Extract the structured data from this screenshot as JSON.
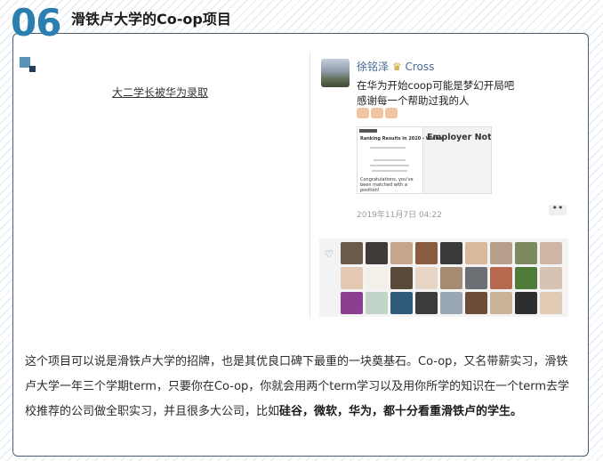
{
  "section": {
    "number": "06",
    "title": "滑铁卢大学的Co-op项目"
  },
  "link_caption": "大二学长被华为录取",
  "post": {
    "name": "徐铭泽",
    "name_suffix": "Cross",
    "line1": "在华为开始coop可能是梦幻开局吧",
    "line2": "感谢每一个帮助过我的人",
    "attachment": {
      "doc_heading": "Ranking Results in 2020 - Winter",
      "doc_text": "Congratulations, you've been matched with a position!",
      "employer_label": "Employer Note"
    },
    "timestamp": "2019年11月7日 04:22",
    "more_label": "••"
  },
  "likes": {
    "heart_icon": "heart-icon",
    "avatar_colors": [
      "#6b5a4a",
      "#3f3a36",
      "#c7a58a",
      "#8a5c3f",
      "#3a3a3a",
      "#d9b99c",
      "#b6a08c",
      "#7d8a5e",
      "#cfb5a3",
      "#e3c9b2",
      "#f3f0ea",
      "#5a4a3a",
      "#e7d6c6",
      "#a58b72",
      "#6c6f73",
      "#b7694f",
      "#4e7a3a",
      "#d8c3b3",
      "#8a3f8f",
      "#c2d3c8",
      "#2f5a7a",
      "#3b3b3b",
      "#9aa7b4",
      "#6d4c3a",
      "#c9b49a",
      "#2e2e2e",
      "#e2cbb4"
    ]
  },
  "paragraph": {
    "part1": "这个项目可以说是滑铁卢大学的招牌，也是其优良口碑下最重的一块奠基石。Co-op，又名带薪实习，滑铁卢大学一年三个学期term，只要你在Co-op，你就会用两个term学习以及用你所学的知识在一个term去学校推荐的公司做全职实习，并且很多大公司，比如",
    "bold": "硅谷，微软，华为，都十分看重滑铁卢的学生。"
  }
}
